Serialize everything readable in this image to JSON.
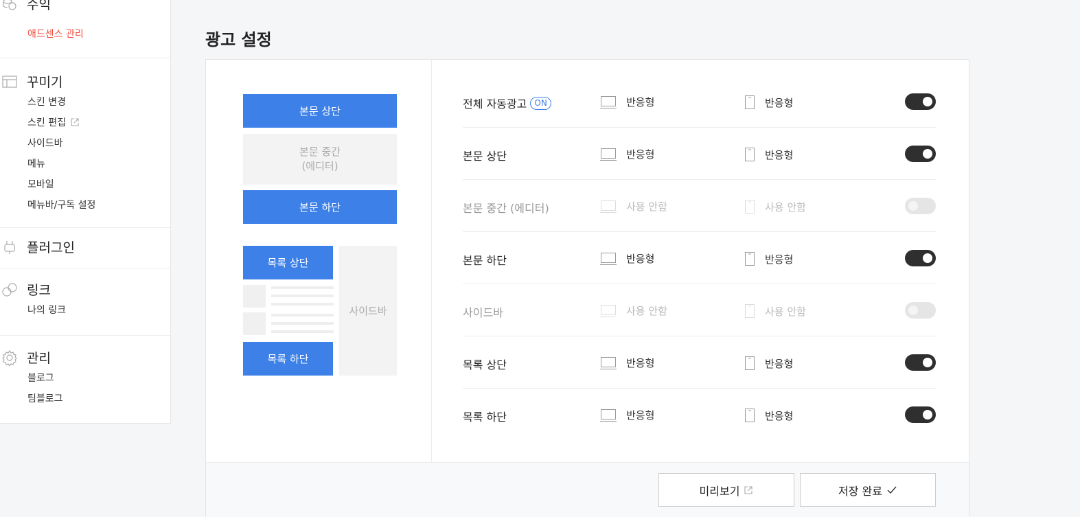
{
  "sidebar": {
    "sections": [
      {
        "title": "수익",
        "icon": "coins-icon",
        "items": [
          {
            "label": "애드센스 관리",
            "active": true
          }
        ]
      },
      {
        "title": "꾸미기",
        "icon": "layout-icon",
        "items": [
          {
            "label": "스킨 변경"
          },
          {
            "label": "스킨 편집",
            "external": true
          },
          {
            "label": "사이드바"
          },
          {
            "label": "메뉴"
          },
          {
            "label": "모바일"
          },
          {
            "label": "메뉴바/구독 설정"
          }
        ]
      },
      {
        "title": "플러그인",
        "icon": "plug-icon",
        "items": []
      },
      {
        "title": "링크",
        "icon": "link-icon",
        "items": [
          {
            "label": "나의 링크"
          }
        ]
      },
      {
        "title": "관리",
        "icon": "gear-icon",
        "items": [
          {
            "label": "블로그"
          },
          {
            "label": "팀블로그"
          }
        ]
      }
    ]
  },
  "main": {
    "title": "광고 설정",
    "preview": {
      "body_top": "본문 상단",
      "body_middle_line1": "본문 중간",
      "body_middle_line2": "(에디터)",
      "body_bottom": "본문 하단",
      "list_top": "목록 상단",
      "list_bottom": "목록 하단",
      "sidebar": "사이드바"
    },
    "on_badge": "ON",
    "rows": [
      {
        "label": "전체 자동광고",
        "badge": true,
        "pc": "반응형",
        "mobile": "반응형",
        "enabled": true
      },
      {
        "label": "본문 상단",
        "pc": "반응형",
        "mobile": "반응형",
        "enabled": true
      },
      {
        "label": "본문 중간 (에디터)",
        "pc": "사용 안함",
        "mobile": "사용 안함",
        "enabled": false
      },
      {
        "label": "본문 하단",
        "pc": "반응형",
        "mobile": "반응형",
        "enabled": true
      },
      {
        "label": "사이드바",
        "pc": "사용 안함",
        "mobile": "사용 안함",
        "enabled": false
      },
      {
        "label": "목록 상단",
        "pc": "반응형",
        "mobile": "반응형",
        "enabled": true
      },
      {
        "label": "목록 하단",
        "pc": "반응형",
        "mobile": "반응형",
        "enabled": true
      }
    ],
    "footer": {
      "preview_label": "미리보기",
      "save_label": "저장 완료"
    }
  }
}
